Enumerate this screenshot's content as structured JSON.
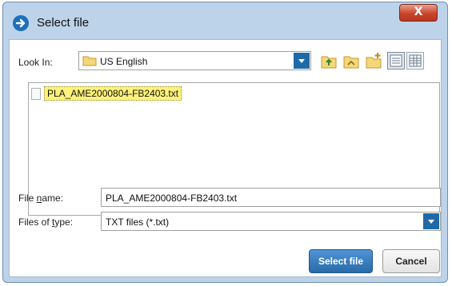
{
  "window": {
    "title": "Select file",
    "close_label": "X"
  },
  "look_in": {
    "label": "Look In:",
    "value": "US English"
  },
  "toolbar": {
    "icons": [
      "up-folder-icon",
      "home-folder-icon",
      "new-folder-icon",
      "list-view-icon",
      "details-view-icon"
    ]
  },
  "file_list": {
    "items": [
      {
        "name": "PLA_AME2000804-FB2403.txt"
      }
    ]
  },
  "file_name": {
    "label": "File name:",
    "value": "PLA_AME2000804-FB2403.txt"
  },
  "file_type": {
    "label": "Files of type:",
    "value": "TXT files (*.txt)"
  },
  "buttons": {
    "select": "Select file",
    "cancel": "Cancel"
  },
  "colors": {
    "accent": "#2a6aa9",
    "selection": "#fff27a",
    "frame": "#bcd3ea"
  }
}
